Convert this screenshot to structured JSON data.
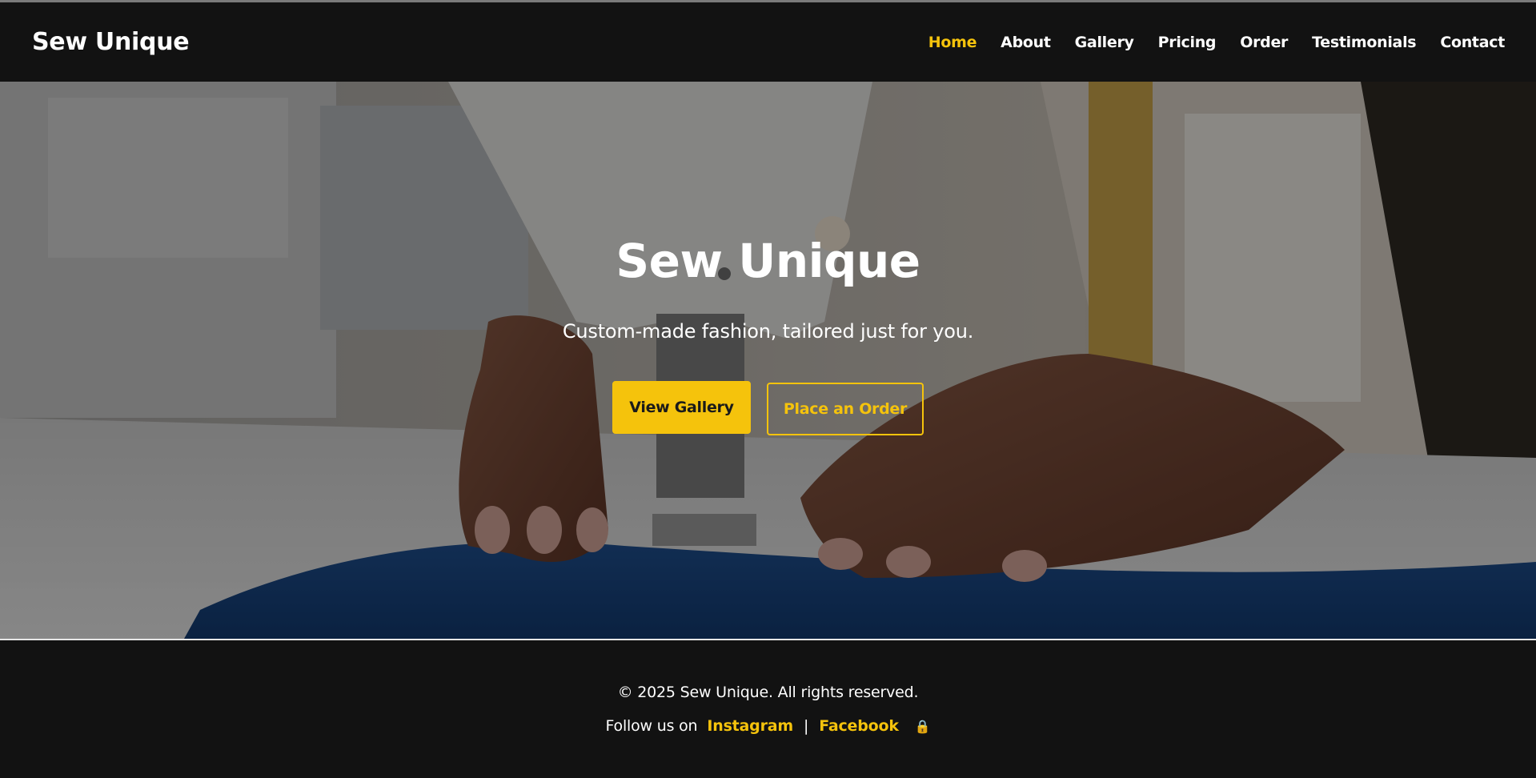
{
  "brand": "Sew Unique",
  "nav": {
    "items": [
      {
        "label": "Home",
        "active": true
      },
      {
        "label": "About"
      },
      {
        "label": "Gallery"
      },
      {
        "label": "Pricing"
      },
      {
        "label": "Order"
      },
      {
        "label": "Testimonials"
      },
      {
        "label": "Contact"
      }
    ]
  },
  "hero": {
    "title": "Sew Unique",
    "subtitle": "Custom-made fashion, tailored just for you.",
    "primary_button": "View Gallery",
    "secondary_button": "Place an Order"
  },
  "footer": {
    "copyright": "© 2025 Sew Unique. All rights reserved.",
    "follow_label": "Follow us on",
    "instagram": "Instagram",
    "separator": "|",
    "facebook": "Facebook",
    "lock_icon": "lock-icon"
  },
  "colors": {
    "accent": "#f5c30c",
    "background": "#121212",
    "text": "#ffffff"
  }
}
